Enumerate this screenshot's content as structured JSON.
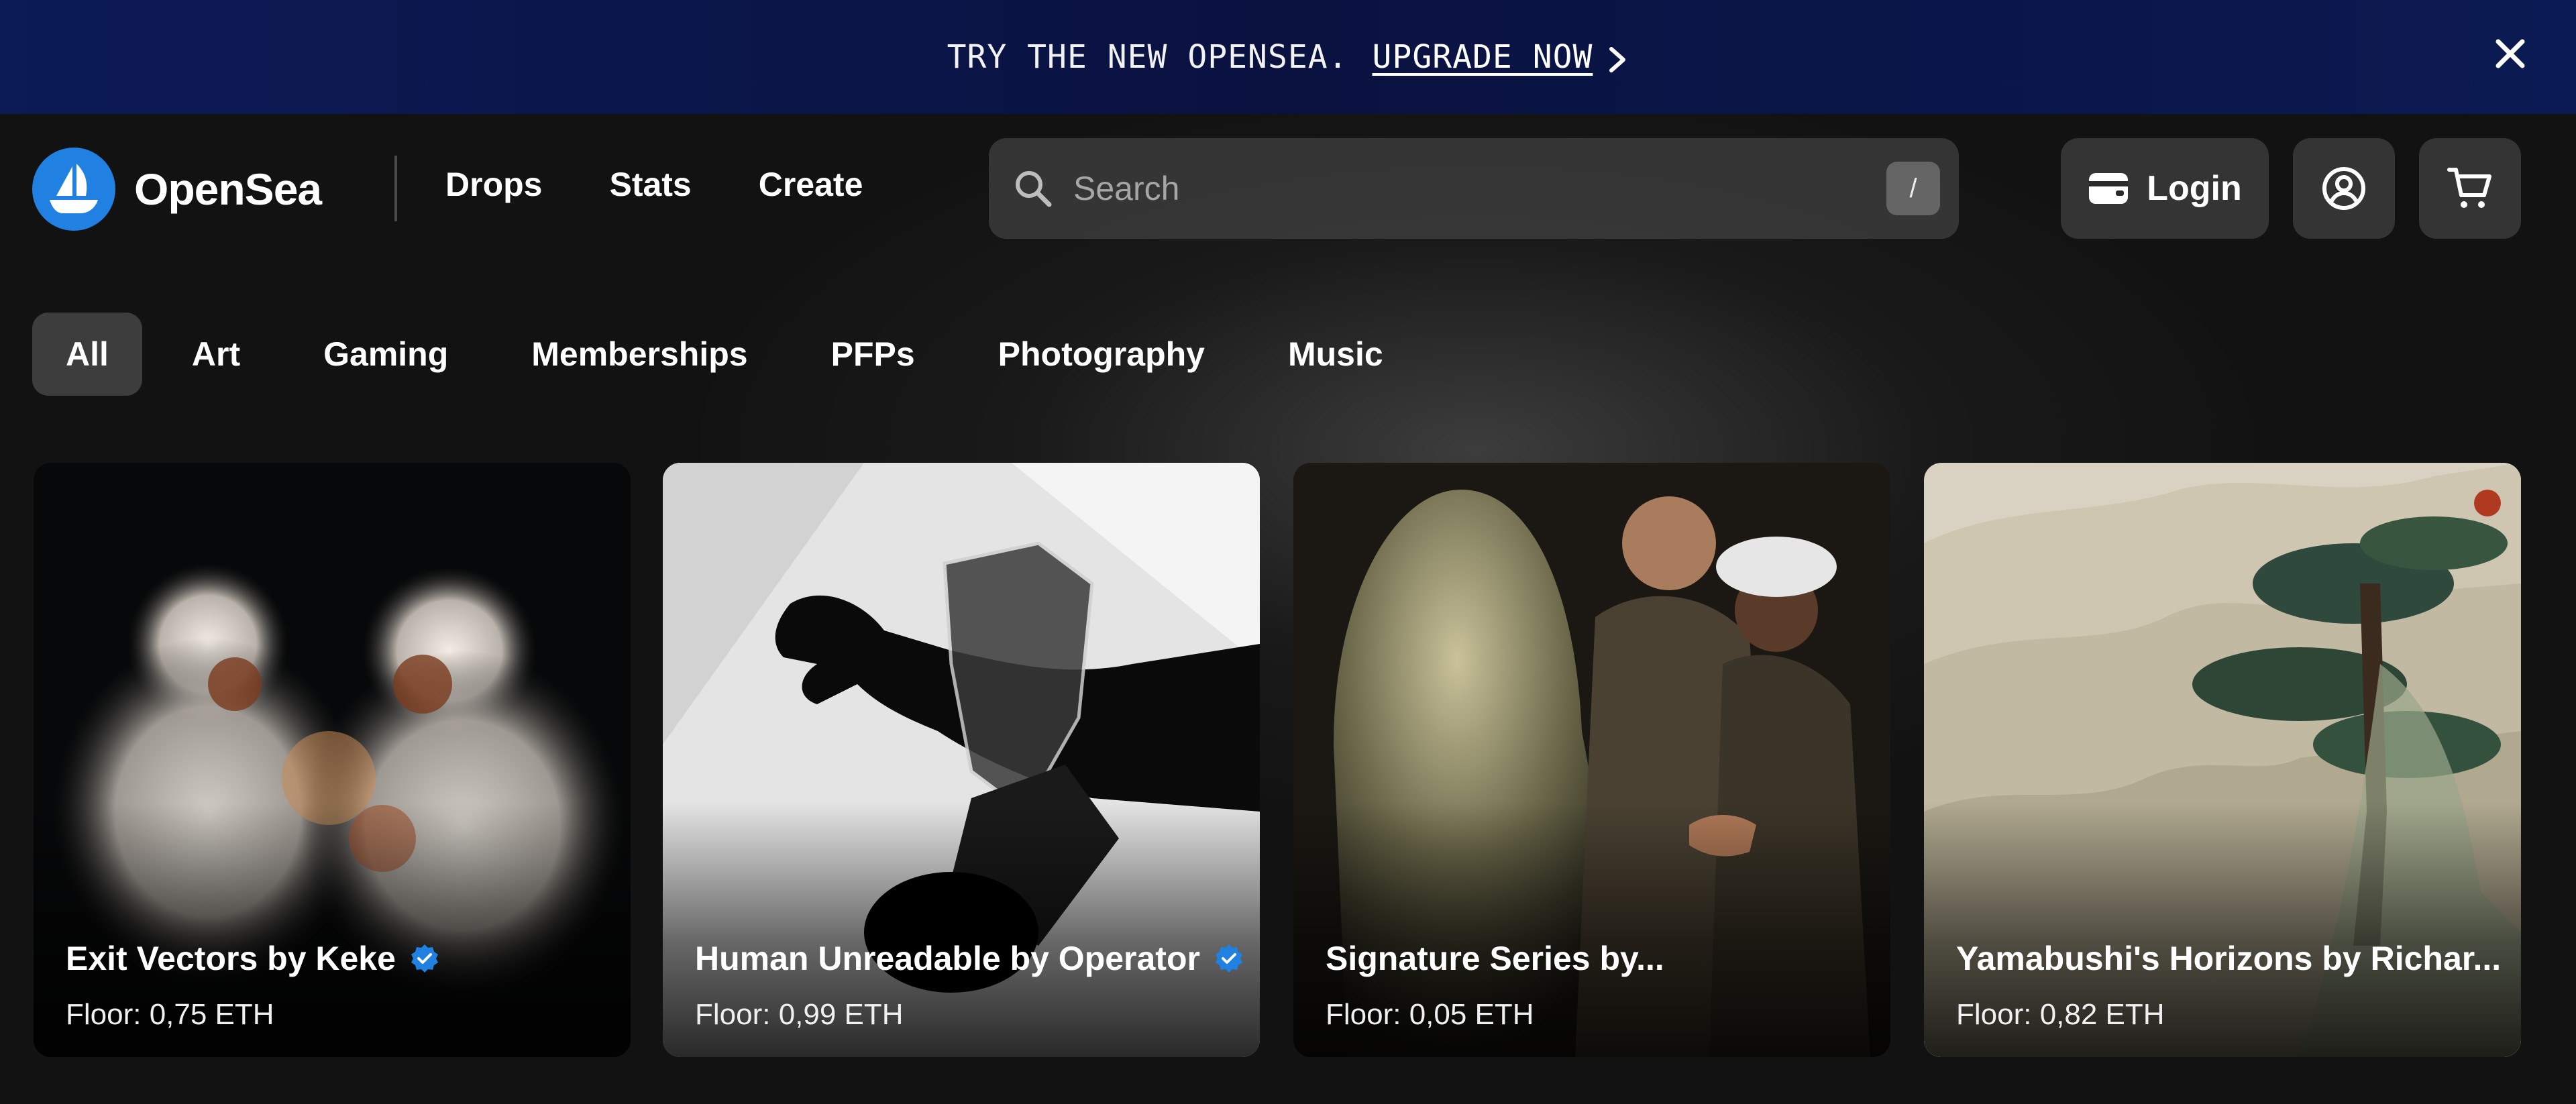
{
  "banner": {
    "text": "TRY THE NEW OPENSEA.",
    "link": "UPGRADE NOW"
  },
  "header": {
    "brand": "OpenSea",
    "nav": [
      "Drops",
      "Stats",
      "Create"
    ],
    "search_placeholder": "Search",
    "search_shortcut": "/",
    "login_label": "Login"
  },
  "categories": [
    "All",
    "Art",
    "Gaming",
    "Memberships",
    "PFPs",
    "Photography",
    "Music"
  ],
  "active_category": "All",
  "cards": [
    {
      "title": "Exit Vectors by Keke",
      "verified": true,
      "floor": "Floor: 0,75 ETH"
    },
    {
      "title": "Human Unreadable by Operator",
      "verified": true,
      "floor": "Floor: 0,99 ETH"
    },
    {
      "title": "Signature Series by...",
      "verified": false,
      "floor": "Floor: 0,05 ETH"
    },
    {
      "title": "Yamabushi's Horizons by Richar...",
      "verified": false,
      "floor": "Floor: 0,82 ETH"
    }
  ],
  "colors": {
    "brand_blue": "#2081e2",
    "banner_bg": "#0a1240",
    "page_bg": "#121212"
  }
}
